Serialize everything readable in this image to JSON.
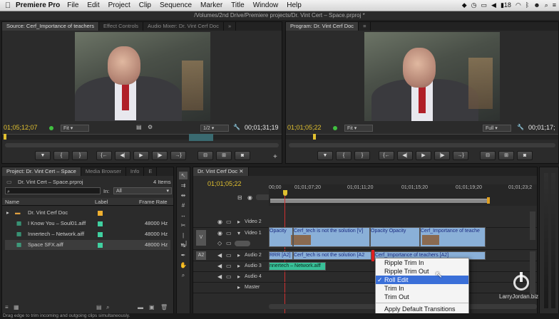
{
  "menubar": {
    "app_name": "Premiere Pro",
    "items": [
      "File",
      "Edit",
      "Project",
      "Clip",
      "Sequence",
      "Marker",
      "Title",
      "Window",
      "Help"
    ],
    "battery_num": "18"
  },
  "window_title": "/Volumes/2nd Drive/Premiere projects/Dr. Vint Cert – Space.prproj *",
  "source": {
    "tabs": [
      "Source: Cerf_Importance of teachers",
      "Effect Controls",
      "Audio Mixer: Dr. Vint Cerf Doc"
    ],
    "tab_more": "»",
    "timecode_in": "01;05;12;07",
    "fit_label": "Fit",
    "fraction": "1/2",
    "timecode_dur": "00;01;31;19"
  },
  "program": {
    "tab": "Program: Dr. Vint Cerf Doc",
    "timecode_in": "01;01;05;22",
    "fit_label": "Fit",
    "quality": "Full",
    "timecode_dur": "00;01;17;"
  },
  "project": {
    "tabs": [
      "Project: Dr. Vint Cert – Space",
      "Media Browser",
      "Info",
      "E"
    ],
    "filename": "Dr. Vint Cert – Space.prproj",
    "item_count": "4 Items",
    "in_label": "In:",
    "in_value": "All",
    "columns": [
      "Name",
      "Label",
      "Frame Rate"
    ],
    "rows": [
      {
        "name": "Dr. Vint Cerf Doc",
        "rate": "",
        "color": "#f0b030"
      },
      {
        "name": "I Know You – Soul01.aiff",
        "rate": "48000 Hz",
        "color": "#40d0a0"
      },
      {
        "name": "Innertech – Network.aiff",
        "rate": "48000 Hz",
        "color": "#40d0a0"
      },
      {
        "name": "Space SFX.aiff",
        "rate": "48000 Hz",
        "color": "#40d0a0"
      }
    ]
  },
  "timeline": {
    "tab": "Dr. Vint Cerf Doc",
    "timecode": "01;01;05;22",
    "ruler": [
      "00;00",
      "01;01;07;20",
      "01;01;11;20",
      "01;01;15;20",
      "01;01;19;20",
      "01;01;23;2"
    ],
    "tracks": {
      "video2": "Video 2",
      "video1": "Video 1",
      "audio2": "Audio 2",
      "audio3": "Audio 3",
      "audio4": "Audio 4",
      "master": "Master"
    },
    "v_label": "V",
    "a2_label": "A2",
    "clips": {
      "v1_opacity1": "Opacity",
      "v1_clip1": "Cerf_tech is not the solution [V]",
      "v1_opacity2": "Opacity",
      "v1_opacity3": "Opacity",
      "v1_clip2": "Cerf_Importance of teache",
      "a2_clip0": "RRR [A2]",
      "a2_clip1": "Cerf_tech is not the solution [A2",
      "a2_clip2": "Cerf_Importance of teachers [A2]",
      "a3_clip": "nnertech – Network.aiff"
    }
  },
  "context_menu": {
    "items": [
      "Ripple Trim In",
      "Ripple Trim Out",
      "Roll Edit",
      "Trim In",
      "Trim Out",
      "Apply Default Transitions"
    ],
    "checkmark": "✓"
  },
  "status_bar": "Drag edge to trim incoming and outgoing clips simultaneously.",
  "watermark": "LarryJordan.biz"
}
